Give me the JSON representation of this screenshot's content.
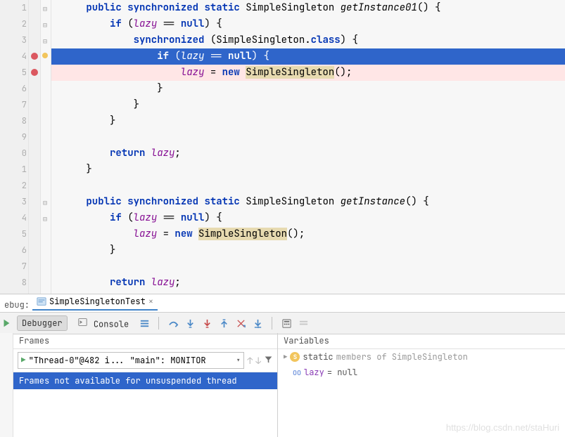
{
  "code": {
    "lines": [
      "1",
      "2",
      "3",
      "4",
      "5",
      "6",
      "7",
      "8",
      "9",
      "0",
      "1",
      "2",
      "3",
      "4",
      "5",
      "6",
      "7",
      "8"
    ],
    "l1": {
      "pre": "      ",
      "kw1": "public",
      "sp1": " ",
      "kw2": "synchronized",
      "sp2": " ",
      "kw3": "static",
      "sp3": " ",
      "ty": "SimpleSingleton ",
      "fn": "getInstance01",
      "rest": "() {"
    },
    "l2": {
      "pre": "          ",
      "kw": "if",
      "sp": " (",
      "f": "lazy",
      "mid": " == ",
      "nul": "null",
      "end": ") {"
    },
    "l3": {
      "pre": "              ",
      "kw": "synchronized",
      "sp": " (",
      "ty": "SimpleSingleton",
      "dot": ".",
      "kw2": "class",
      "end": ") {"
    },
    "l4": {
      "pre": "                  ",
      "kw": "if",
      "sp": " (",
      "f": "lazy",
      "mid": " == ",
      "nul": "null",
      "end": ") {"
    },
    "l5": {
      "pre": "                      ",
      "f": "lazy",
      "mid": " = ",
      "kw": "new",
      "sp": " ",
      "ty": "SimpleSingleton",
      "end": "();"
    },
    "l6": "                  }",
    "l7": "              }",
    "l8": "          }",
    "l9": "",
    "l10": {
      "pre": "          ",
      "kw": "return",
      "sp": " ",
      "f": "lazy",
      "end": ";"
    },
    "l11": "      }",
    "l12": "",
    "l13": {
      "pre": "      ",
      "kw1": "public",
      "sp1": " ",
      "kw2": "synchronized",
      "sp2": " ",
      "kw3": "static",
      "sp3": " ",
      "ty": "SimpleSingleton ",
      "fn": "getInstance",
      "rest": "() {"
    },
    "l14": {
      "pre": "          ",
      "kw": "if",
      "sp": " (",
      "f": "lazy",
      "mid": " == ",
      "nul": "null",
      "end": ") {"
    },
    "l15": {
      "pre": "              ",
      "f": "lazy",
      "mid": " = ",
      "kw": "new",
      "sp": " ",
      "ty": "SimpleSingleton",
      "end": "();"
    },
    "l16": "          }",
    "l17": "",
    "l18": {
      "pre": "          ",
      "kw": "return",
      "sp": " ",
      "f": "lazy",
      "end": ";"
    }
  },
  "debug": {
    "label": "ebug:",
    "tab_name": "SimpleSingletonTest",
    "debugger_tab": "Debugger",
    "console_tab": "Console",
    "frames_hdr": "Frames",
    "vars_hdr": "Variables",
    "thread": "\"Thread-0\"@482 i... \"main\": MONITOR",
    "frame_msg": "Frames not available for unsuspended thread",
    "var_static_pre": "static ",
    "var_static": "members of SimpleSingleton",
    "var_lazy": "lazy",
    "var_lazy_val": " = null"
  },
  "watermark": "https://blog.csdn.net/staHuri"
}
